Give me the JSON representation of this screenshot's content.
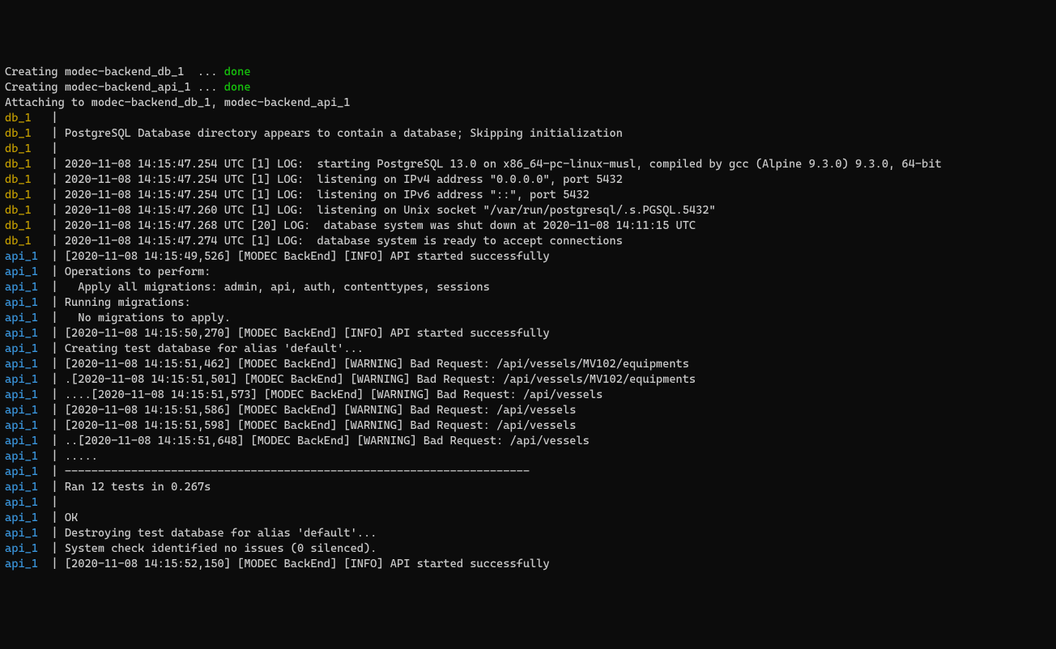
{
  "colors": {
    "bg": "#0c0c0c",
    "white": "#cccccc",
    "green": "#16c60c",
    "yellow": "#c19c00",
    "cyan": "#3a96dd"
  },
  "header": [
    {
      "segments": [
        {
          "t": "Creating modec-backend_db_1  ... ",
          "c": "white"
        },
        {
          "t": "done",
          "c": "green"
        }
      ]
    },
    {
      "segments": [
        {
          "t": "Creating modec-backend_api_1 ... ",
          "c": "white"
        },
        {
          "t": "done",
          "c": "green"
        }
      ]
    },
    {
      "segments": [
        {
          "t": "Attaching to modec-backend_db_1, modec-backend_api_1",
          "c": "white"
        }
      ]
    }
  ],
  "log": [
    {
      "prefix": "db_1   ",
      "prefix_c": "yellow",
      "msg": ""
    },
    {
      "prefix": "db_1   ",
      "prefix_c": "yellow",
      "msg": "PostgreSQL Database directory appears to contain a database; Skipping initialization"
    },
    {
      "prefix": "db_1   ",
      "prefix_c": "yellow",
      "msg": ""
    },
    {
      "prefix": "db_1   ",
      "prefix_c": "yellow",
      "msg": "2020-11-08 14:15:47.254 UTC [1] LOG:  starting PostgreSQL 13.0 on x86_64-pc-linux-musl, compiled by gcc (Alpine 9.3.0) 9.3.0, 64-bit"
    },
    {
      "prefix": "db_1   ",
      "prefix_c": "yellow",
      "msg": "2020-11-08 14:15:47.254 UTC [1] LOG:  listening on IPv4 address \"0.0.0.0\", port 5432"
    },
    {
      "prefix": "db_1   ",
      "prefix_c": "yellow",
      "msg": "2020-11-08 14:15:47.254 UTC [1] LOG:  listening on IPv6 address \"::\", port 5432"
    },
    {
      "prefix": "db_1   ",
      "prefix_c": "yellow",
      "msg": "2020-11-08 14:15:47.260 UTC [1] LOG:  listening on Unix socket \"/var/run/postgresql/.s.PGSQL.5432\""
    },
    {
      "prefix": "db_1   ",
      "prefix_c": "yellow",
      "msg": "2020-11-08 14:15:47.268 UTC [20] LOG:  database system was shut down at 2020-11-08 14:11:15 UTC"
    },
    {
      "prefix": "db_1   ",
      "prefix_c": "yellow",
      "msg": "2020-11-08 14:15:47.274 UTC [1] LOG:  database system is ready to accept connections"
    },
    {
      "prefix": "api_1  ",
      "prefix_c": "cyan",
      "msg": "[2020-11-08 14:15:49,526] [MODEC BackEnd] [INFO] API started successfully"
    },
    {
      "prefix": "api_1  ",
      "prefix_c": "cyan",
      "msg": "Operations to perform:"
    },
    {
      "prefix": "api_1  ",
      "prefix_c": "cyan",
      "msg": "  Apply all migrations: admin, api, auth, contenttypes, sessions"
    },
    {
      "prefix": "api_1  ",
      "prefix_c": "cyan",
      "msg": "Running migrations:"
    },
    {
      "prefix": "api_1  ",
      "prefix_c": "cyan",
      "msg": "  No migrations to apply."
    },
    {
      "prefix": "api_1  ",
      "prefix_c": "cyan",
      "msg": "[2020-11-08 14:15:50,270] [MODEC BackEnd] [INFO] API started successfully"
    },
    {
      "prefix": "api_1  ",
      "prefix_c": "cyan",
      "msg": "Creating test database for alias 'default'..."
    },
    {
      "prefix": "api_1  ",
      "prefix_c": "cyan",
      "msg": "[2020-11-08 14:15:51,462] [MODEC BackEnd] [WARNING] Bad Request: /api/vessels/MV102/equipments"
    },
    {
      "prefix": "api_1  ",
      "prefix_c": "cyan",
      "msg": ".[2020-11-08 14:15:51,501] [MODEC BackEnd] [WARNING] Bad Request: /api/vessels/MV102/equipments"
    },
    {
      "prefix": "api_1  ",
      "prefix_c": "cyan",
      "msg": "....[2020-11-08 14:15:51,573] [MODEC BackEnd] [WARNING] Bad Request: /api/vessels"
    },
    {
      "prefix": "api_1  ",
      "prefix_c": "cyan",
      "msg": "[2020-11-08 14:15:51,586] [MODEC BackEnd] [WARNING] Bad Request: /api/vessels"
    },
    {
      "prefix": "api_1  ",
      "prefix_c": "cyan",
      "msg": "[2020-11-08 14:15:51,598] [MODEC BackEnd] [WARNING] Bad Request: /api/vessels"
    },
    {
      "prefix": "api_1  ",
      "prefix_c": "cyan",
      "msg": "..[2020-11-08 14:15:51,648] [MODEC BackEnd] [WARNING] Bad Request: /api/vessels"
    },
    {
      "prefix": "api_1  ",
      "prefix_c": "cyan",
      "msg": "....."
    },
    {
      "prefix": "api_1  ",
      "prefix_c": "cyan",
      "msg": "----------------------------------------------------------------------"
    },
    {
      "prefix": "api_1  ",
      "prefix_c": "cyan",
      "msg": "Ran 12 tests in 0.267s"
    },
    {
      "prefix": "api_1  ",
      "prefix_c": "cyan",
      "msg": ""
    },
    {
      "prefix": "api_1  ",
      "prefix_c": "cyan",
      "msg": "OK"
    },
    {
      "prefix": "api_1  ",
      "prefix_c": "cyan",
      "msg": "Destroying test database for alias 'default'..."
    },
    {
      "prefix": "api_1  ",
      "prefix_c": "cyan",
      "msg": "System check identified no issues (0 silenced)."
    },
    {
      "prefix": "api_1  ",
      "prefix_c": "cyan",
      "msg": "[2020-11-08 14:15:52,150] [MODEC BackEnd] [INFO] API started successfully"
    }
  ],
  "pipe": "| "
}
